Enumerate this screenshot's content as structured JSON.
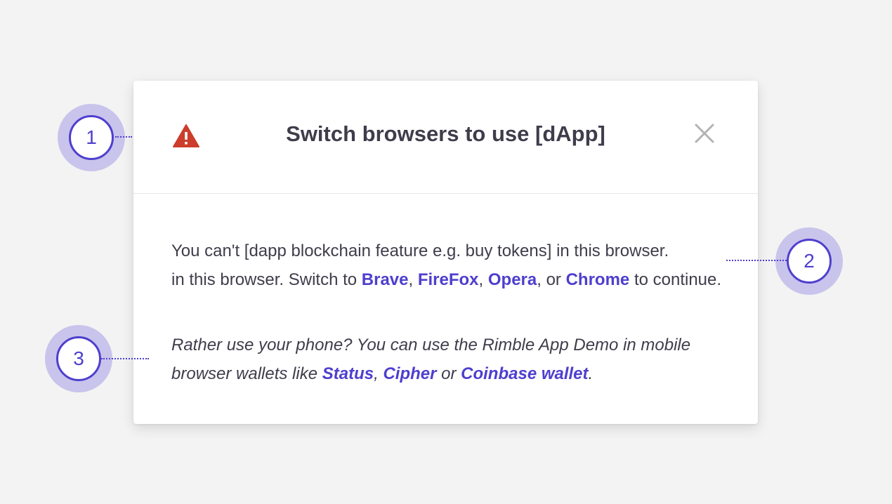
{
  "modal": {
    "title": "Switch browsers to use [dApp]",
    "warning_icon_color": "#cc3d2b",
    "close_icon": "close-icon",
    "body": {
      "line1_text": "You can't [dapp blockchain feature e.g. buy tokens] in this browser.",
      "line2_prefix": "in this browser. Switch to ",
      "browser_links": [
        "Brave",
        "FireFox",
        "Opera",
        "Chrome"
      ],
      "sep1": ", ",
      "sep2": ", ",
      "sep3": ", or ",
      "line2_suffix": " to continue.",
      "mobile_prefix": "Rather use your phone? You can use the Rimble App Demo in mobile browser wallets like ",
      "wallet_links": [
        "Status",
        "Cipher",
        "Coinbase wallet"
      ],
      "wsep1": ", ",
      "wsep2": " or ",
      "mobile_suffix": "."
    }
  },
  "callouts": [
    "1",
    "2",
    "3"
  ],
  "colors": {
    "accent": "#4e3fce",
    "callout_halo": "#c9c4ec",
    "background": "#f3f3f3",
    "text": "#3f3d4b",
    "warning": "#cc3d2b"
  }
}
